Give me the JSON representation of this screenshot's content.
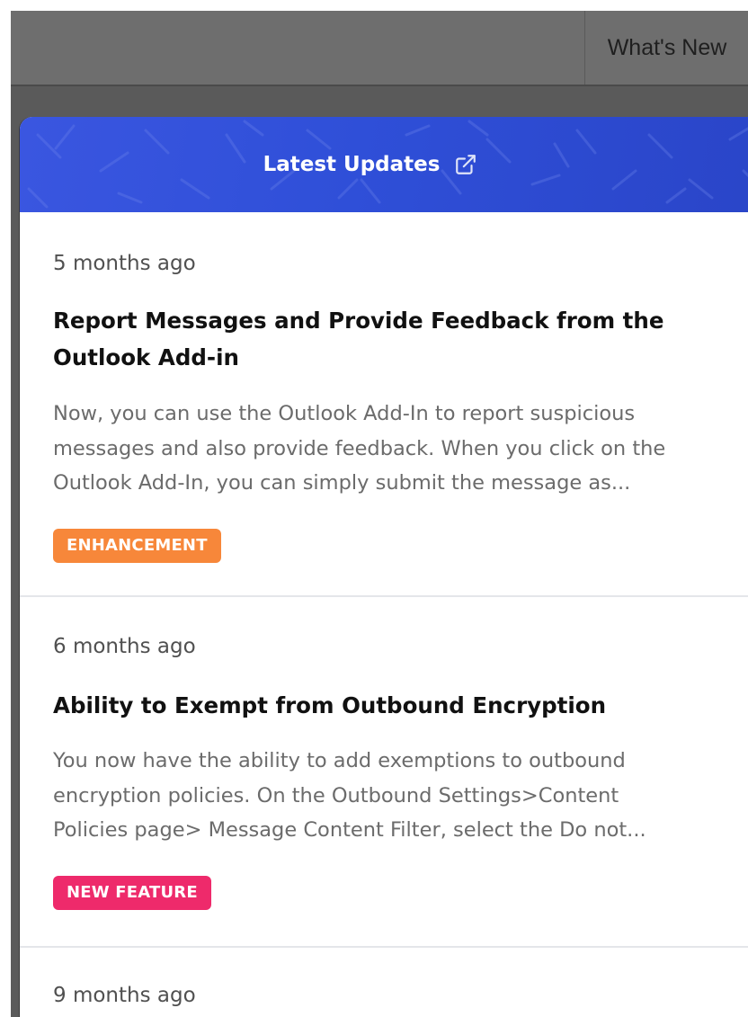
{
  "topbar": {
    "whats_new_label": "What's New"
  },
  "panel": {
    "title": "Latest Updates",
    "external_link_icon": "external-link-icon",
    "header_color": "#3050da"
  },
  "entries": [
    {
      "time": "5 months ago",
      "title": "Report Messages and Provide Feedback from the Outlook Add-in",
      "title_line1": "Report Messages and Provide Feedback from the",
      "title_line2": "Outlook Add-in",
      "description_line1": "Now, you can use the Outlook Add-In to report suspicious",
      "description_line2": "messages and also provide feedback. When you click on the",
      "description_line3": "Outlook Add-In, you can simply submit the message as...",
      "badge": "ENHANCEMENT",
      "badge_color": "#f7873a"
    },
    {
      "time": "6 months ago",
      "title": "Ability to Exempt from Outbound Encryption",
      "description_line1": "You now have the ability to add exemptions to outbound",
      "description_line2": "encryption policies. On the Outbound Settings>Content",
      "description_line3": "Policies page> Message Content Filter, select the Do not...",
      "badge": "NEW FEATURE",
      "badge_color": "#ee2a6b"
    },
    {
      "time": "9 months ago"
    }
  ]
}
